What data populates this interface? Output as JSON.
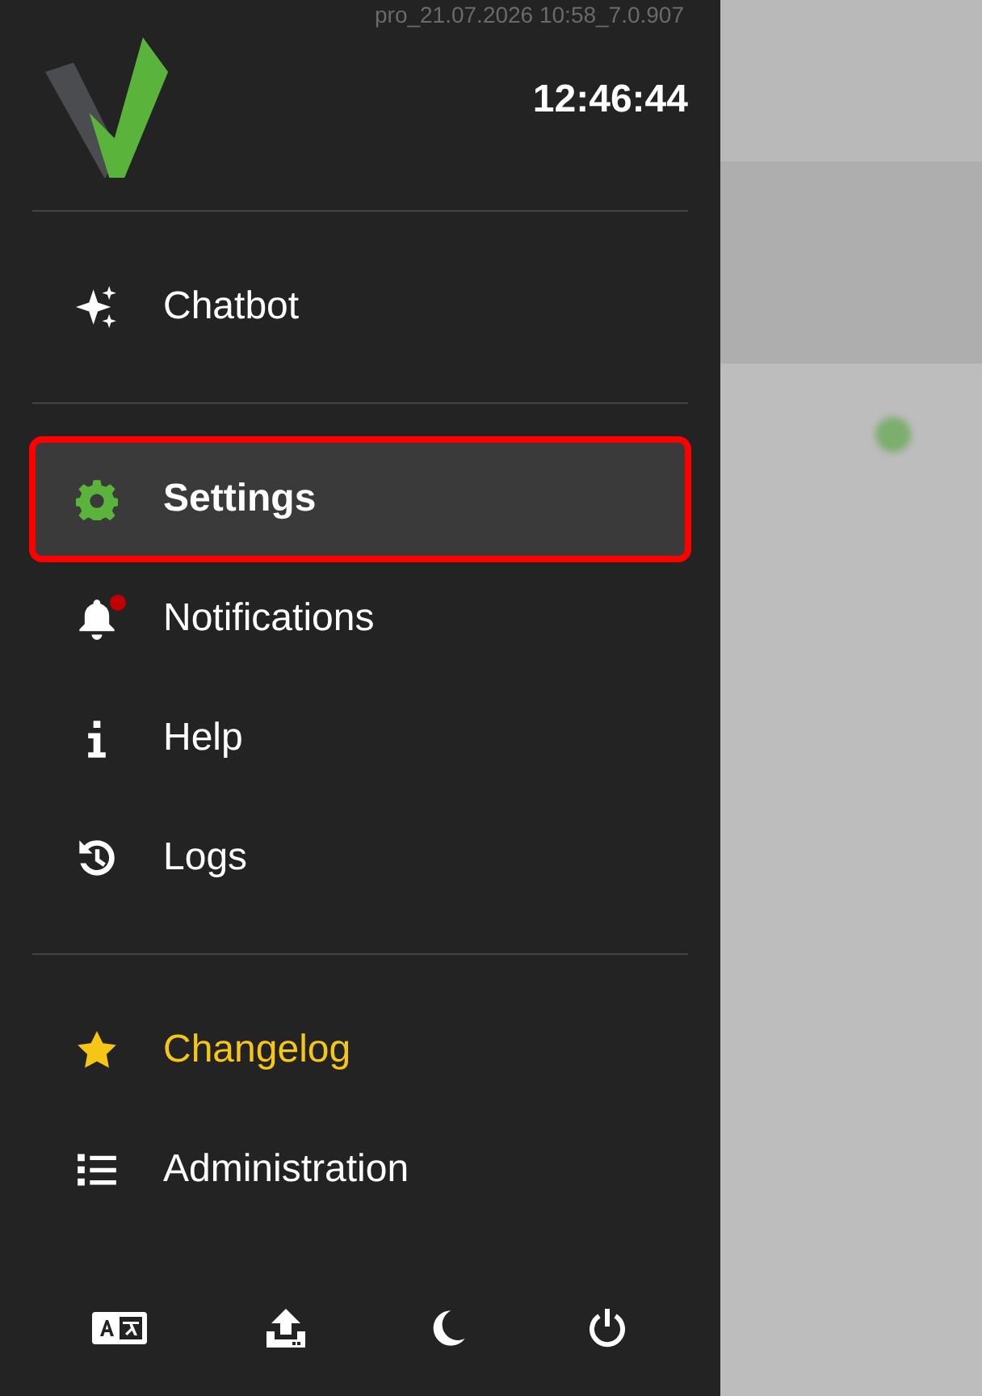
{
  "version": "pro_21.07.2026 10:58_7.0.907",
  "clock": "12:46:44",
  "sections": [
    {
      "items": [
        {
          "label": "Chatbot",
          "selected": false,
          "highlighted": false,
          "badge": false,
          "color": "#ffffff"
        }
      ]
    },
    {
      "items": [
        {
          "label": "Settings",
          "selected": true,
          "highlighted": true,
          "badge": false,
          "color": "#ffffff"
        },
        {
          "label": "Notifications",
          "selected": false,
          "highlighted": false,
          "badge": true,
          "color": "#ffffff"
        },
        {
          "label": "Help",
          "selected": false,
          "highlighted": false,
          "badge": false,
          "color": "#ffffff"
        },
        {
          "label": "Logs",
          "selected": false,
          "highlighted": false,
          "badge": false,
          "color": "#ffffff"
        }
      ]
    },
    {
      "items": [
        {
          "label": "Changelog",
          "selected": false,
          "highlighted": false,
          "badge": false,
          "color": "#f5c518"
        },
        {
          "label": "Administration",
          "selected": false,
          "highlighted": false,
          "badge": false,
          "color": "#ffffff"
        }
      ]
    }
  ]
}
